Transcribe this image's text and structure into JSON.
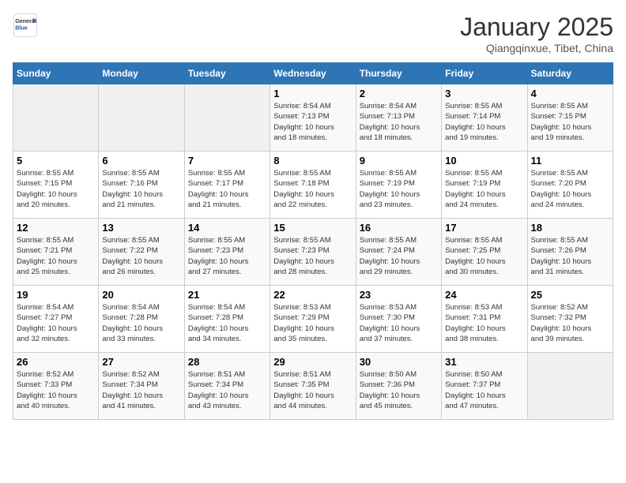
{
  "header": {
    "logo_general": "General",
    "logo_blue": "Blue",
    "title": "January 2025",
    "subtitle": "Qiangqinxue, Tibet, China"
  },
  "weekdays": [
    "Sunday",
    "Monday",
    "Tuesday",
    "Wednesday",
    "Thursday",
    "Friday",
    "Saturday"
  ],
  "weeks": [
    [
      {
        "day": "",
        "info": ""
      },
      {
        "day": "",
        "info": ""
      },
      {
        "day": "",
        "info": ""
      },
      {
        "day": "1",
        "info": "Sunrise: 8:54 AM\nSunset: 7:13 PM\nDaylight: 10 hours\nand 18 minutes."
      },
      {
        "day": "2",
        "info": "Sunrise: 8:54 AM\nSunset: 7:13 PM\nDaylight: 10 hours\nand 18 minutes."
      },
      {
        "day": "3",
        "info": "Sunrise: 8:55 AM\nSunset: 7:14 PM\nDaylight: 10 hours\nand 19 minutes."
      },
      {
        "day": "4",
        "info": "Sunrise: 8:55 AM\nSunset: 7:15 PM\nDaylight: 10 hours\nand 19 minutes."
      }
    ],
    [
      {
        "day": "5",
        "info": "Sunrise: 8:55 AM\nSunset: 7:15 PM\nDaylight: 10 hours\nand 20 minutes."
      },
      {
        "day": "6",
        "info": "Sunrise: 8:55 AM\nSunset: 7:16 PM\nDaylight: 10 hours\nand 21 minutes."
      },
      {
        "day": "7",
        "info": "Sunrise: 8:55 AM\nSunset: 7:17 PM\nDaylight: 10 hours\nand 21 minutes."
      },
      {
        "day": "8",
        "info": "Sunrise: 8:55 AM\nSunset: 7:18 PM\nDaylight: 10 hours\nand 22 minutes."
      },
      {
        "day": "9",
        "info": "Sunrise: 8:55 AM\nSunset: 7:19 PM\nDaylight: 10 hours\nand 23 minutes."
      },
      {
        "day": "10",
        "info": "Sunrise: 8:55 AM\nSunset: 7:19 PM\nDaylight: 10 hours\nand 24 minutes."
      },
      {
        "day": "11",
        "info": "Sunrise: 8:55 AM\nSunset: 7:20 PM\nDaylight: 10 hours\nand 24 minutes."
      }
    ],
    [
      {
        "day": "12",
        "info": "Sunrise: 8:55 AM\nSunset: 7:21 PM\nDaylight: 10 hours\nand 25 minutes."
      },
      {
        "day": "13",
        "info": "Sunrise: 8:55 AM\nSunset: 7:22 PM\nDaylight: 10 hours\nand 26 minutes."
      },
      {
        "day": "14",
        "info": "Sunrise: 8:55 AM\nSunset: 7:23 PM\nDaylight: 10 hours\nand 27 minutes."
      },
      {
        "day": "15",
        "info": "Sunrise: 8:55 AM\nSunset: 7:23 PM\nDaylight: 10 hours\nand 28 minutes."
      },
      {
        "day": "16",
        "info": "Sunrise: 8:55 AM\nSunset: 7:24 PM\nDaylight: 10 hours\nand 29 minutes."
      },
      {
        "day": "17",
        "info": "Sunrise: 8:55 AM\nSunset: 7:25 PM\nDaylight: 10 hours\nand 30 minutes."
      },
      {
        "day": "18",
        "info": "Sunrise: 8:55 AM\nSunset: 7:26 PM\nDaylight: 10 hours\nand 31 minutes."
      }
    ],
    [
      {
        "day": "19",
        "info": "Sunrise: 8:54 AM\nSunset: 7:27 PM\nDaylight: 10 hours\nand 32 minutes."
      },
      {
        "day": "20",
        "info": "Sunrise: 8:54 AM\nSunset: 7:28 PM\nDaylight: 10 hours\nand 33 minutes."
      },
      {
        "day": "21",
        "info": "Sunrise: 8:54 AM\nSunset: 7:28 PM\nDaylight: 10 hours\nand 34 minutes."
      },
      {
        "day": "22",
        "info": "Sunrise: 8:53 AM\nSunset: 7:29 PM\nDaylight: 10 hours\nand 35 minutes."
      },
      {
        "day": "23",
        "info": "Sunrise: 8:53 AM\nSunset: 7:30 PM\nDaylight: 10 hours\nand 37 minutes."
      },
      {
        "day": "24",
        "info": "Sunrise: 8:53 AM\nSunset: 7:31 PM\nDaylight: 10 hours\nand 38 minutes."
      },
      {
        "day": "25",
        "info": "Sunrise: 8:52 AM\nSunset: 7:32 PM\nDaylight: 10 hours\nand 39 minutes."
      }
    ],
    [
      {
        "day": "26",
        "info": "Sunrise: 8:52 AM\nSunset: 7:33 PM\nDaylight: 10 hours\nand 40 minutes."
      },
      {
        "day": "27",
        "info": "Sunrise: 8:52 AM\nSunset: 7:34 PM\nDaylight: 10 hours\nand 41 minutes."
      },
      {
        "day": "28",
        "info": "Sunrise: 8:51 AM\nSunset: 7:34 PM\nDaylight: 10 hours\nand 43 minutes."
      },
      {
        "day": "29",
        "info": "Sunrise: 8:51 AM\nSunset: 7:35 PM\nDaylight: 10 hours\nand 44 minutes."
      },
      {
        "day": "30",
        "info": "Sunrise: 8:50 AM\nSunset: 7:36 PM\nDaylight: 10 hours\nand 45 minutes."
      },
      {
        "day": "31",
        "info": "Sunrise: 8:50 AM\nSunset: 7:37 PM\nDaylight: 10 hours\nand 47 minutes."
      },
      {
        "day": "",
        "info": ""
      }
    ]
  ]
}
